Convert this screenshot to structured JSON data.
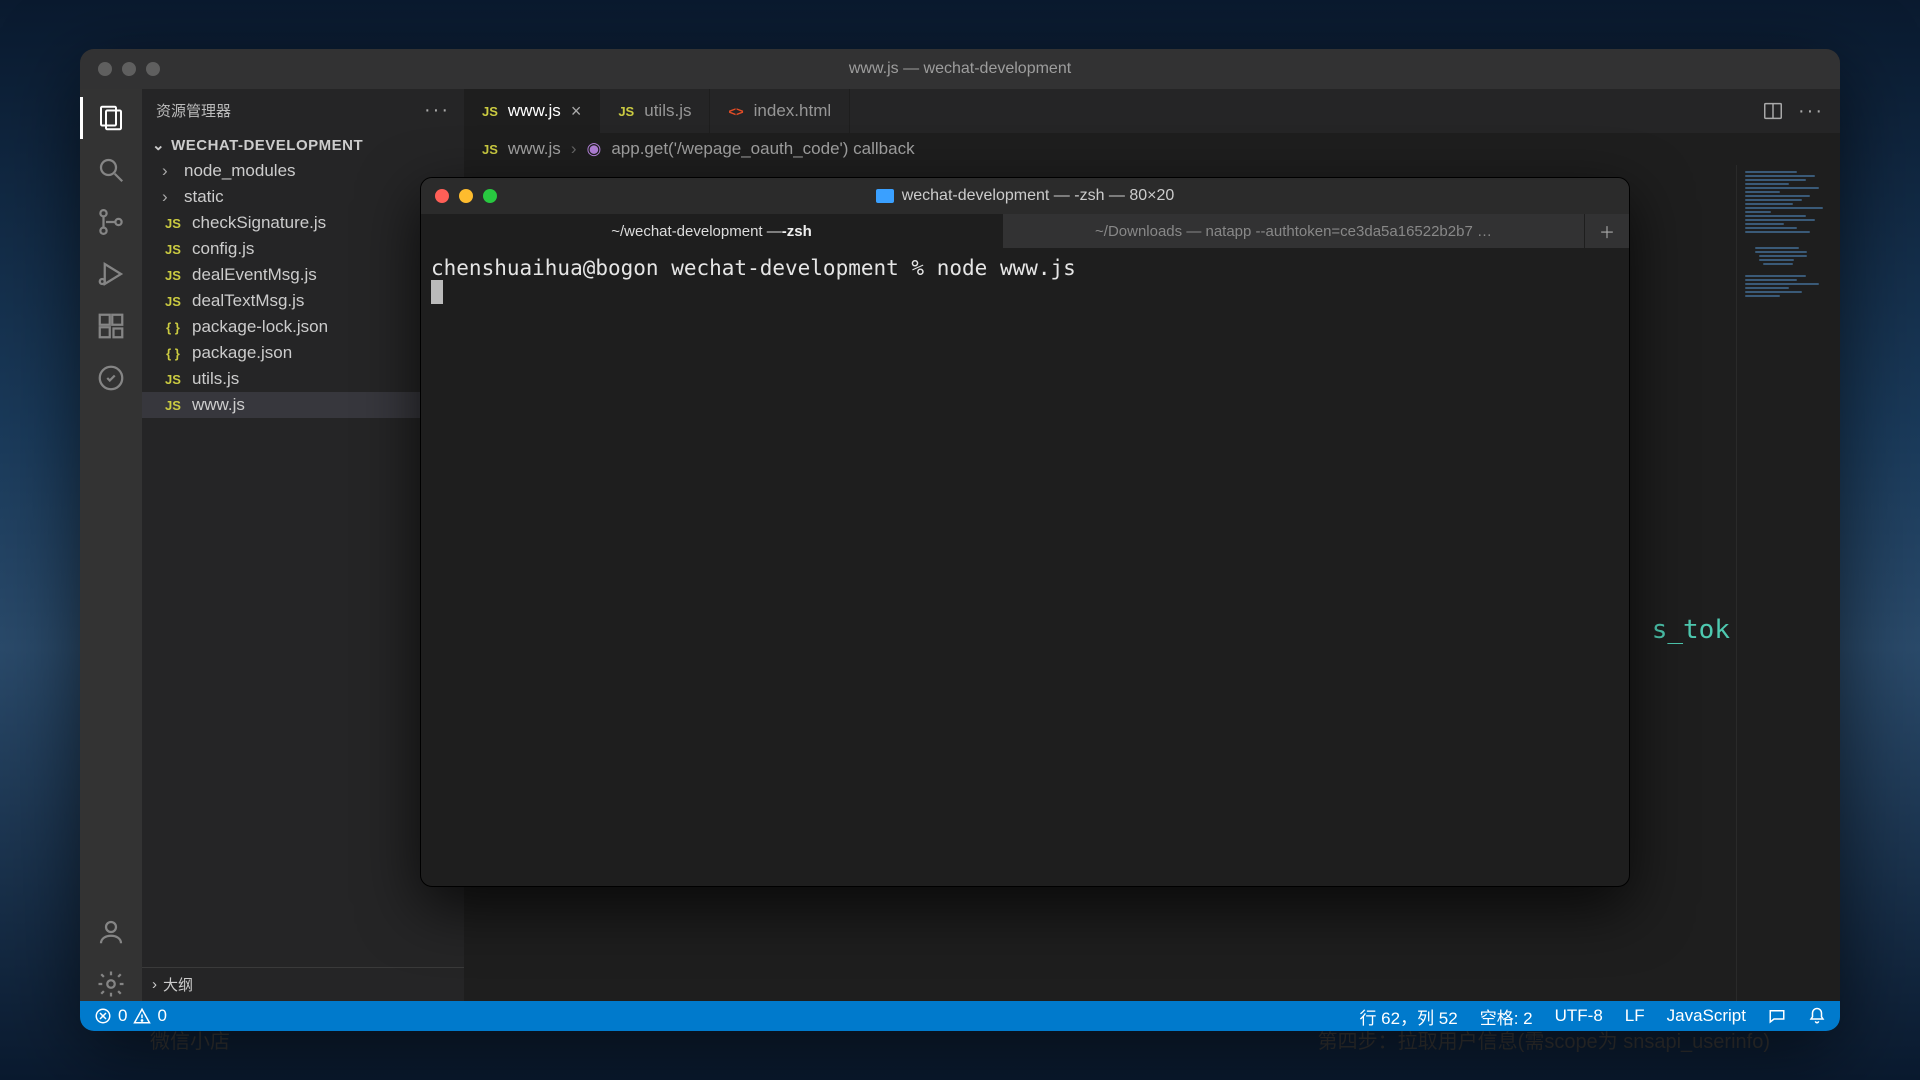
{
  "window": {
    "title": "www.js — wechat-development"
  },
  "sidebar": {
    "title": "资源管理器",
    "folder": "WECHAT-DEVELOPMENT",
    "items": [
      {
        "label": "node_modules",
        "type": "folder"
      },
      {
        "label": "static",
        "type": "folder"
      },
      {
        "label": "checkSignature.js",
        "type": "js"
      },
      {
        "label": "config.js",
        "type": "js"
      },
      {
        "label": "dealEventMsg.js",
        "type": "js"
      },
      {
        "label": "dealTextMsg.js",
        "type": "js"
      },
      {
        "label": "package-lock.json",
        "type": "json"
      },
      {
        "label": "package.json",
        "type": "json"
      },
      {
        "label": "utils.js",
        "type": "js"
      },
      {
        "label": "www.js",
        "type": "js",
        "selected": true
      }
    ],
    "outline": "大纲"
  },
  "tabs": [
    {
      "label": "www.js",
      "type": "js",
      "active": true,
      "closeable": true
    },
    {
      "label": "utils.js",
      "type": "js"
    },
    {
      "label": "index.html",
      "type": "html"
    }
  ],
  "breadcrumb": {
    "file": "www.js",
    "symbol": "app.get('/wepage_oauth_code') callback"
  },
  "editor": {
    "peek_text": "s_tok"
  },
  "statusbar": {
    "errors": "0",
    "warnings": "0",
    "cursor": "行 62，列 52",
    "spaces": "空格: 2",
    "encoding": "UTF-8",
    "eol": "LF",
    "language": "JavaScript"
  },
  "terminal": {
    "title": "wechat-development — -zsh — 80×20",
    "tabs": [
      {
        "path": "~/wechat-development — ",
        "proc": "-zsh",
        "active": true
      },
      {
        "full": "~/Downloads — natapp --authtoken=ce3da5a16522b2b7  …"
      }
    ],
    "line": "chenshuaihua@bogon wechat-development % node www.js"
  },
  "bottom": {
    "left": "微信小店",
    "right": "第四步：拉取用户信息(需scope为 snsapi_userinfo)"
  }
}
